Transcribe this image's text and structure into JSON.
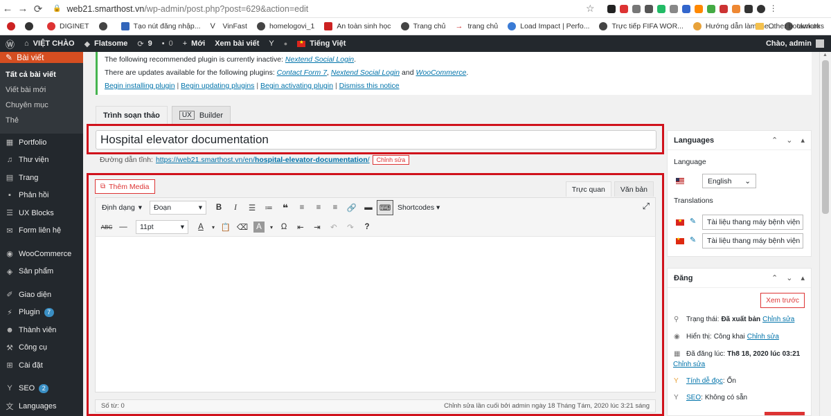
{
  "browser": {
    "url_host": "web21.smarthost.vn",
    "url_path": "/wp-admin/post.php?post=629&action=edit"
  },
  "bookmarks": {
    "items": [
      "DIGINET",
      "Tạo nút đăng nhập...",
      "VinFast",
      "homelogovi_1",
      "An toàn sinh học",
      "Trang chủ",
      "trang chủ",
      "Load Impact | Perfo...",
      "Trực tiếp FIFA WOR...",
      "Hướng dẫn làm me...",
      "tawk.to"
    ],
    "other": "Other bookmarks"
  },
  "adminbar": {
    "site": "VIỆT CHÀO",
    "theme": "Flatsome",
    "updates": "9",
    "comments": "0",
    "new": "Mới",
    "view": "Xem bài viết",
    "lang": "Tiếng Việt",
    "greeting": "Chào, admin"
  },
  "sidebar": {
    "current": "Bài viết",
    "sub": [
      "Tất cả bài viết",
      "Viết bài mới",
      "Chuyên mục",
      "Thẻ"
    ],
    "items1": [
      "Portfolio",
      "Thư viện",
      "Trang",
      "Phản hồi",
      "UX Blocks",
      "Form liên hệ"
    ],
    "items2": [
      "WooCommerce",
      "Sản phẩm"
    ],
    "items3": [
      "Giao diện",
      "Plugin",
      "Thành viên",
      "Công cụ",
      "Cài đặt"
    ],
    "plugin_badge": "7",
    "items4": [
      "SEO",
      "Languages"
    ],
    "seo_badge": "2"
  },
  "notice": {
    "l1_pre": "The following recommended plugin is currently inactive:",
    "l1_plugin": "Nextend Social Login",
    "l2_pre": "There are updates available for the following plugins:",
    "l2_p1": "Contact Form 7",
    "l2_p2": "Nextend Social Login",
    "l2_and": "and",
    "l2_p3": "WooCommerce",
    "links": [
      "Begin installing plugin",
      "Begin updating plugins",
      "Begin activating plugin",
      "Dismiss this notice"
    ]
  },
  "tabs": {
    "editor": "Trình soạn thảo",
    "ux": "UX",
    "builder": "Builder"
  },
  "post": {
    "title": "Hospital elevator documentation",
    "permalink_label": "Đường dẫn tĩnh:",
    "permalink_pre": "https://web21.smarthost.vn/en/",
    "permalink_slug": "hospital-elevator-documentation",
    "permalink_post": "/",
    "edit_slug": "Chỉnh sửa"
  },
  "editor": {
    "add_media": "Thêm Media",
    "visual": "Trực quan",
    "text": "Văn bản",
    "format": "Định dạng",
    "paragraph": "Đoạn",
    "shortcodes": "Shortcodes",
    "font_size": "11pt",
    "word_count": "Số từ: 0",
    "last_edit": "Chỉnh sửa lần cuối bởi admin ngày 18 Tháng Tám, 2020 lúc 3:21 sáng"
  },
  "languages_box": {
    "title": "Languages",
    "language_label": "Language",
    "selected": "English",
    "translations_label": "Translations",
    "t_vi": "Tài liệu thang máy bệnh viện",
    "t_zh": "Tài liệu thang máy bệnh viện"
  },
  "publish_box": {
    "title": "Đăng",
    "preview": "Xem trước",
    "status_label": "Trạng thái:",
    "status_value": "Đã xuất bản",
    "status_edit": "Chỉnh sửa",
    "visibility_label": "Hiển thị:",
    "visibility_value": "Công khai",
    "visibility_edit": "Chỉnh sửa",
    "date_label": "Đã đăng lúc:",
    "date_value": "Th8 18, 2020 lúc 03:21",
    "date_edit": "Chỉnh sửa",
    "readability_label": "Tính dễ đọc",
    "readability_value": "Ổn",
    "seo_label": "SEO",
    "seo_value": "Không có sẵn"
  },
  "colors": {
    "admin_bar": "#23282d",
    "accent": "#d54e21",
    "highlight": "#d0111b",
    "link": "#0073aa"
  }
}
